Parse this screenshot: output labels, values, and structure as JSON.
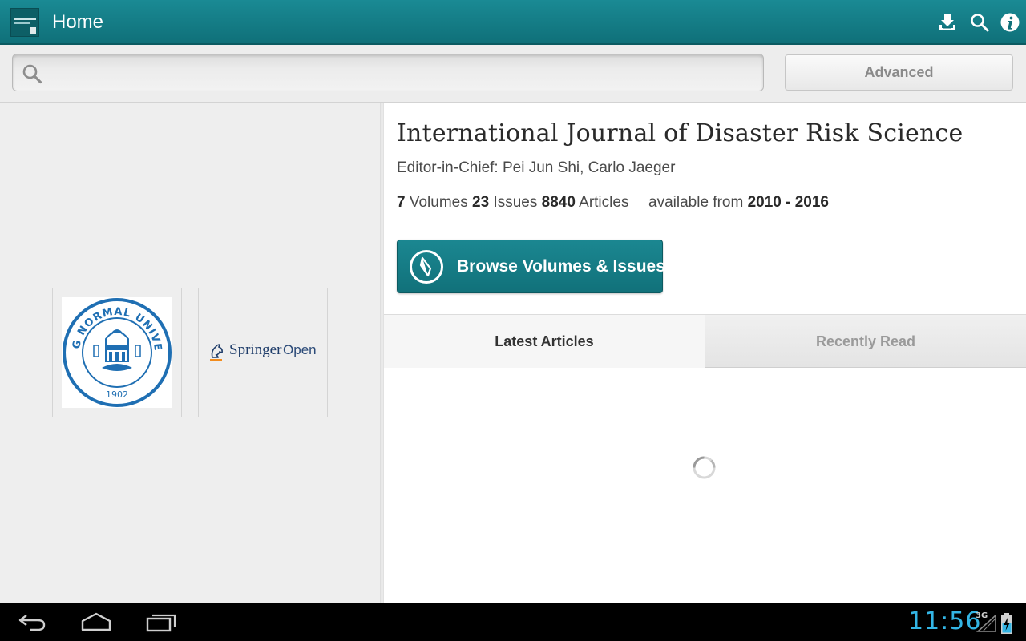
{
  "actionbar": {
    "title": "Home",
    "icons": [
      "download-icon",
      "search-icon",
      "info-icon"
    ]
  },
  "search": {
    "value": "",
    "placeholder": "",
    "advanced_label": "Advanced"
  },
  "journal": {
    "title": "International Journal of Disaster Risk Science",
    "editors": "Editor-in-Chief: Pei Jun Shi, Carlo Jaeger",
    "volumes_count": "7",
    "volumes_label": "Volumes",
    "issues_count": "23",
    "issues_label": "Issues",
    "articles_count": "8840",
    "articles_label": "Articles",
    "available_label": "available from",
    "year_range": "2010 - 2016"
  },
  "browse": {
    "label": "Browse Volumes & Issues",
    "icon": "compass-icon"
  },
  "tabs": [
    {
      "label": "Latest Articles",
      "selected": true
    },
    {
      "label": "Recently Read",
      "selected": false
    }
  ],
  "logos": {
    "bnu_text": "BEIJING NORMAL UNIVERSITY",
    "bnu_year": "1902",
    "springer_name": "Springer",
    "springer_open": "Open"
  },
  "system": {
    "clock": "11:56",
    "network": "3G",
    "nav": [
      "back-icon",
      "home-icon",
      "recents-icon"
    ]
  },
  "colors": {
    "accent": "#11717a",
    "clock": "#33b5e5",
    "bnu_blue": "#1f6fb3",
    "springer_orange": "#f28c1e"
  }
}
